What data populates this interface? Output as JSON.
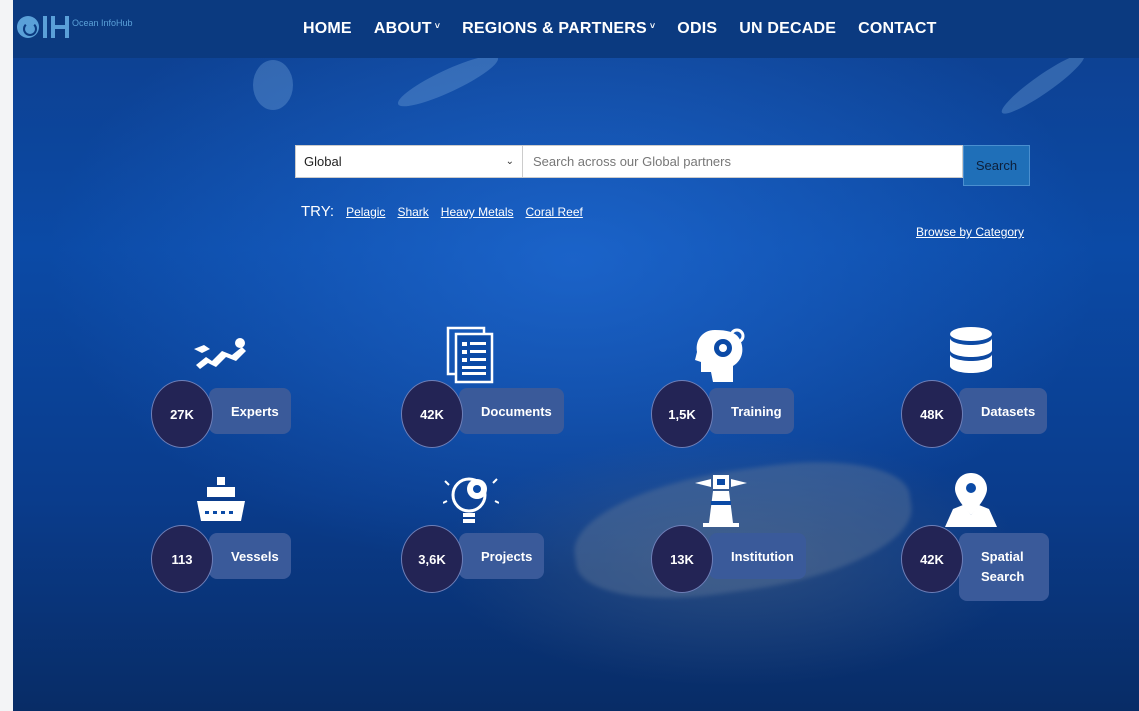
{
  "logo": {
    "text": "Ocean InfoHub"
  },
  "nav": {
    "items": [
      {
        "label": "HOME",
        "has_dropdown": false
      },
      {
        "label": "ABOUT",
        "has_dropdown": true
      },
      {
        "label": "REGIONS & PARTNERS",
        "has_dropdown": true
      },
      {
        "label": "ODIS",
        "has_dropdown": false
      },
      {
        "label": "UN DECADE",
        "has_dropdown": false
      },
      {
        "label": "CONTACT",
        "has_dropdown": false
      }
    ]
  },
  "search": {
    "region_selected": "Global",
    "placeholder": "Search across our Global partners",
    "button_label": "Search"
  },
  "try": {
    "label": "TRY:",
    "links": [
      "Pelagic",
      "Shark",
      "Heavy Metals",
      "Coral Reef"
    ]
  },
  "browse_label": "Browse by Category",
  "categories": [
    {
      "count": "27K",
      "label": "Experts",
      "icon": "diver-icon"
    },
    {
      "count": "42K",
      "label": "Documents",
      "icon": "document-icon"
    },
    {
      "count": "1,5K",
      "label": "Training",
      "icon": "head-gear-icon"
    },
    {
      "count": "48K",
      "label": "Datasets",
      "icon": "database-icon"
    },
    {
      "count": "113",
      "label": "Vessels",
      "icon": "ship-icon"
    },
    {
      "count": "3,6K",
      "label": "Projects",
      "icon": "lightbulb-gear-icon"
    },
    {
      "count": "13K",
      "label": "Institution",
      "icon": "lighthouse-icon"
    },
    {
      "count": "42K",
      "label": "Spatial Search",
      "label_line1": "Spatial",
      "label_line2": "Search",
      "icon": "map-pin-icon"
    }
  ],
  "colors": {
    "nav_bg": "#0b3a80",
    "count_circle": "#232455",
    "pill_bg": "#3a5a9a",
    "search_button": "#1f6fb8"
  }
}
